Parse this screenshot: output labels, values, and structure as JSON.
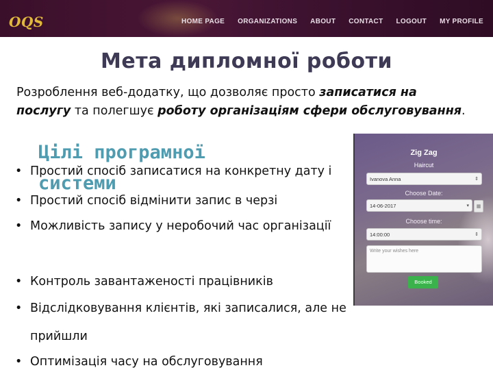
{
  "header": {
    "logo": "OQS",
    "nav": [
      "HOME PAGE",
      "ORGANIZATIONS",
      "ABOUT",
      "CONTACT",
      "LOGOUT",
      "MY PROFILE"
    ]
  },
  "slide": {
    "title": "Мета дипломної роботи",
    "intro": {
      "p1": "Розроблення веб-додатку, що дозволяє просто ",
      "b1": "записатися на послугу",
      "p2": " та полегшує ",
      "b2": "роботу організаціям сфери обслуговування",
      "p3": "."
    },
    "subtitle": "Цілі програмної системи",
    "bullets": [
      "Простий спосіб записатися на конкретну дату і",
      "Простий спосіб відмінити запис в черзі",
      "Можливість запису у неробочий час організації",
      "Контроль завантаженості працівників",
      "Відслідковування клієнтів, які записалися, але не",
      "прийшли",
      "Оптимізація часу на обслуговування"
    ]
  },
  "booking_form": {
    "org_name": "Zig Zag",
    "service": "Haircut",
    "client_value": "Ivanova Anna",
    "date_label": "Choose Date:",
    "date_value": "14-06-2017",
    "time_label": "Choose time:",
    "time_value": "14:00:00",
    "wishes_placeholder": "Write your wishes here",
    "submit_label": "Booked"
  }
}
